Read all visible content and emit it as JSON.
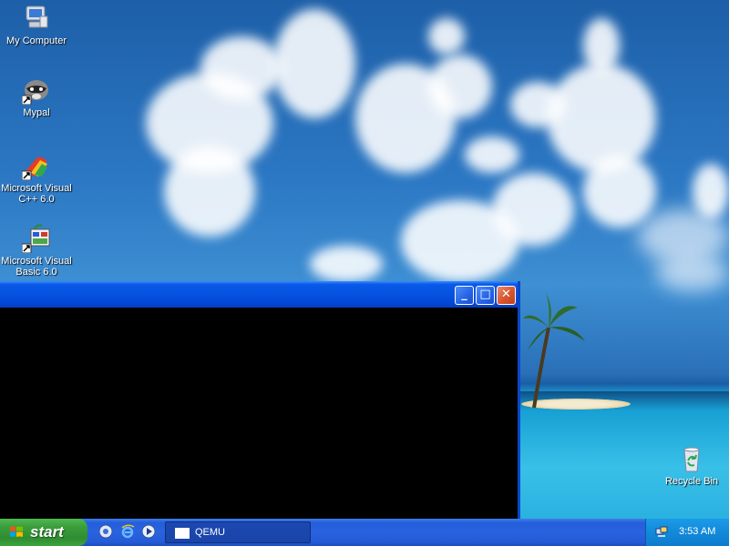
{
  "desktop": {
    "icons": [
      {
        "name": "my-computer",
        "label": "My Computer"
      },
      {
        "name": "mypal",
        "label": "Mypal"
      },
      {
        "name": "msvc",
        "label_line1": "Microsoft Visual",
        "label_line2": "C++ 6.0"
      },
      {
        "name": "msvb",
        "label_line1": "Microsoft Visual",
        "label_line2": "Basic 6.0"
      },
      {
        "name": "recycle-bin",
        "label": "Recycle Bin"
      }
    ]
  },
  "window": {
    "minimize_glyph": "_",
    "maximize_glyph": "□",
    "close_glyph": "✕"
  },
  "taskbar": {
    "start_label": "start",
    "task_button_label": "QEMU",
    "clock": "3:53 AM"
  },
  "colors": {
    "taskbar_blue": "#245edc",
    "start_green": "#3a9e3b",
    "tray_blue": "#1289da",
    "close_red": "#d7552d"
  }
}
